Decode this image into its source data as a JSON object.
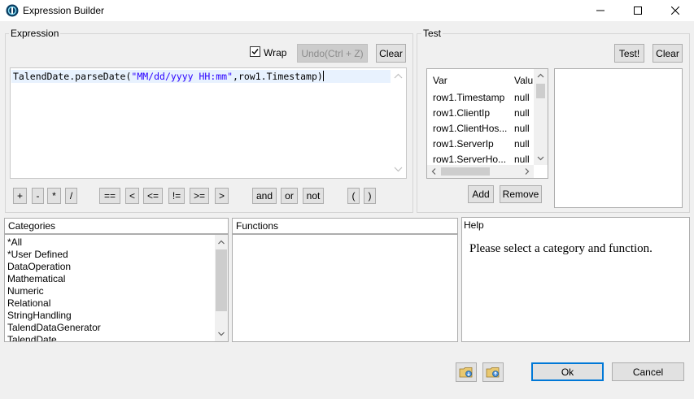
{
  "window": {
    "title": "Expression Builder",
    "icon": "talend-icon"
  },
  "expression": {
    "legend": "Expression",
    "wrap_label": "Wrap",
    "wrap_checked": true,
    "undo_label": "Undo(Ctrl + Z)",
    "clear_label": "Clear",
    "code_prefix": "TalendDate.parseDate(",
    "code_string": "\"MM/dd/yyyy HH:mm\"",
    "code_suffix": ",row1.Timestamp)",
    "operators": [
      "+",
      "-",
      "*",
      "/",
      "==",
      "<",
      "<=",
      "!=",
      ">=",
      ">",
      "and",
      "or",
      "not",
      "(",
      ")"
    ]
  },
  "test": {
    "legend": "Test",
    "test_label": "Test!",
    "clear_label": "Clear",
    "col_var": "Var",
    "col_value": "Valu",
    "rows": [
      {
        "var": "row1.Timestamp",
        "value": "null"
      },
      {
        "var": "row1.ClientIp",
        "value": "null"
      },
      {
        "var": "row1.ClientHos...",
        "value": "null"
      },
      {
        "var": "row1.ServerIp",
        "value": "null"
      },
      {
        "var": "row1.ServerHo...",
        "value": "null"
      }
    ],
    "add_label": "Add",
    "remove_label": "Remove"
  },
  "categories": {
    "header": "Categories",
    "items": [
      "*All",
      "*User Defined",
      "DataOperation",
      "Mathematical",
      "Numeric",
      "Relational",
      "StringHandling",
      "TalendDataGenerator",
      "TalendDate"
    ]
  },
  "functions": {
    "header": "Functions"
  },
  "help": {
    "header": "Help",
    "text": "Please select a category and function."
  },
  "footer": {
    "ok_label": "Ok",
    "cancel_label": "Cancel",
    "import_icon": "import-icon",
    "export_icon": "export-icon"
  },
  "colors": {
    "accent": "#0078d7",
    "string_literal": "#2a00ff",
    "line_highlight": "#e8f2fe"
  }
}
